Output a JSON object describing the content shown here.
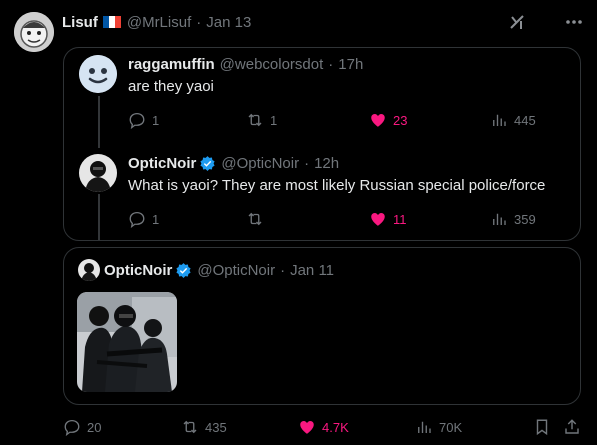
{
  "main_tweet": {
    "author_name": "Lisuf",
    "handle": "@MrLisuf",
    "separator": "·",
    "date": "Jan 13"
  },
  "quoted_thread": {
    "reply_to": {
      "author_name": "raggamuffin",
      "handle": "@webcolorsdot",
      "separator": "·",
      "time": "17h",
      "text": "are they yaoi",
      "replies": "1",
      "reposts": "1",
      "likes": "23",
      "views": "445"
    },
    "reply": {
      "author_name": "OpticNoir",
      "handle": "@OpticNoir",
      "separator": "·",
      "time": "12h",
      "text": "What is yaoi? They are most likely Russian special police/force",
      "replies": "1",
      "reposts": "",
      "likes": "11",
      "views": "359"
    }
  },
  "quoted_original": {
    "author_name": "OpticNoir",
    "handle": "@OpticNoir",
    "separator": "·",
    "date": "Jan 11"
  },
  "actions": {
    "replies": "20",
    "reposts": "435",
    "likes": "4.7K",
    "views": "70K"
  },
  "colors": {
    "background": "#000000",
    "text": "#e7e9ea",
    "muted": "#71767b",
    "like": "#f91880",
    "verified": "#1d9bf0",
    "border": "#2f3336"
  }
}
